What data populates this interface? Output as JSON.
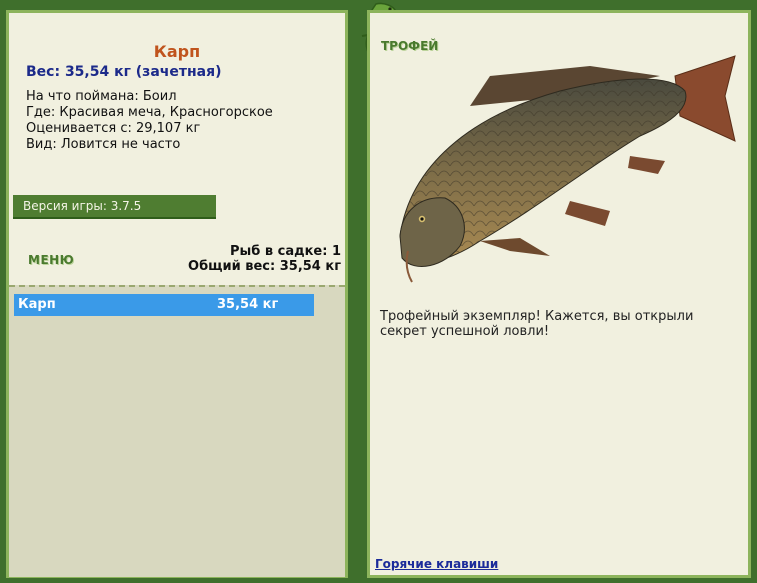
{
  "fish": {
    "name": "Карп",
    "weight_line": "Вес: 35,54 кг (зачетная)",
    "caught_on": "На что поймана: Боил",
    "location": "Где: Красивая меча, Красногорское",
    "estimated": "Оценивается с: 29,107 кг",
    "frequency": "Вид: Ловится не часто"
  },
  "version": "Версия игры: 3.7.5",
  "menu_label": "МЕНЮ",
  "keepnet": {
    "count_line": "Рыб в садке: 1",
    "total_line": "Общий вес: 35,54 кг"
  },
  "list": [
    {
      "name": "Карп",
      "weight": "35,54 кг"
    }
  ],
  "right": {
    "section_label": "ТРОФЕЙ",
    "description": "Трофейный экземпляр! Кажется, вы открыли секрет успешной ловли!",
    "hotkeys_link": "Горячие клавиши"
  },
  "colors": {
    "background": "#3f6f2c",
    "panel": "#f1f0df",
    "title": "#c0541d",
    "weight": "#1c2a8a",
    "selected_row": "#3a9ae8"
  },
  "icons": {
    "decoration": "lizard-icon",
    "trophy_image": "carp-fish-icon"
  }
}
